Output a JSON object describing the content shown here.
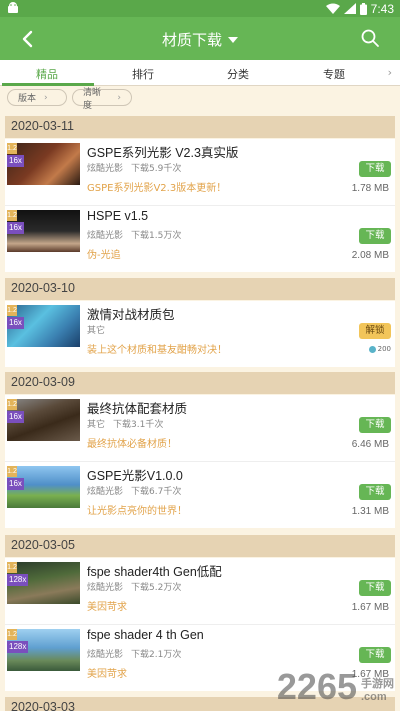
{
  "status_bar": {
    "time": "7:43"
  },
  "app_bar": {
    "title": "材质下载"
  },
  "tabs": [
    {
      "label": "精品",
      "active": true
    },
    {
      "label": "排行",
      "active": false
    },
    {
      "label": "分类",
      "active": false
    },
    {
      "label": "专题",
      "active": false
    }
  ],
  "filters": [
    {
      "label": "版本"
    },
    {
      "label": "清晰度"
    }
  ],
  "groups": [
    {
      "date": "2020-03-11"
    },
    {
      "date": "2020-03-10"
    },
    {
      "date": "2020-03-09"
    },
    {
      "date": "2020-03-05"
    },
    {
      "date": "2020-03-03"
    }
  ],
  "items": [
    {
      "name": "GSPE系列光影 V2.3真实版",
      "author": "炫酷光影",
      "downloads": "下载5.9千次",
      "desc": "GSPE系列光影V2.3版本更新！",
      "action": "下载",
      "size": "1.78 MB",
      "version": "1.2",
      "resolution": "16x",
      "thumb_color": "#7a3a22"
    },
    {
      "name": "HSPE v1.5",
      "author": "炫酷光影",
      "downloads": "下载1.5万次",
      "desc": "伪-光追",
      "action": "下载",
      "size": "2.08 MB",
      "version": "1.2",
      "resolution": "16x",
      "thumb_color": "#2a2a2a"
    },
    {
      "name": "激情对战材质包",
      "author": "其它",
      "downloads": "",
      "desc": "装上这个材质和基友酣畅对决！",
      "action": "解锁",
      "size": "200",
      "version": "1.2",
      "resolution": "16x",
      "thumb_color": "#3a7fb0"
    },
    {
      "name": "最终抗体配套材质",
      "author": "其它",
      "downloads": "下载3.1千次",
      "desc": "最终抗体必备材质！",
      "action": "下载",
      "size": "6.46 MB",
      "version": "1.2",
      "resolution": "16x",
      "thumb_color": "#5a4a3a"
    },
    {
      "name": "GSPE光影V1.0.0",
      "author": "炫酷光影",
      "downloads": "下载6.7千次",
      "desc": "让光影点亮你的世界！",
      "action": "下载",
      "size": "1.31 MB",
      "version": "1.2",
      "resolution": "16x",
      "thumb_color": "#4f8fc8"
    },
    {
      "name": "fspe shader4th Gen低配",
      "author": "炫酷光影",
      "downloads": "下载5.2万次",
      "desc": "美因苛求",
      "action": "下载",
      "size": "1.67 MB",
      "version": "1.2",
      "resolution": "128x",
      "thumb_color": "#4f6a3a"
    },
    {
      "name": "fspe shader 4 th Gen",
      "author": "炫酷光影",
      "downloads": "下载2.1万次",
      "desc": "美因苛求",
      "action": "下载",
      "size": "1.67 MB",
      "version": "1.2",
      "resolution": "128x",
      "thumb_color": "#5f9fd0"
    }
  ],
  "watermark": {
    "brand": "2265",
    "cn": "手游网",
    "url": ".com"
  }
}
